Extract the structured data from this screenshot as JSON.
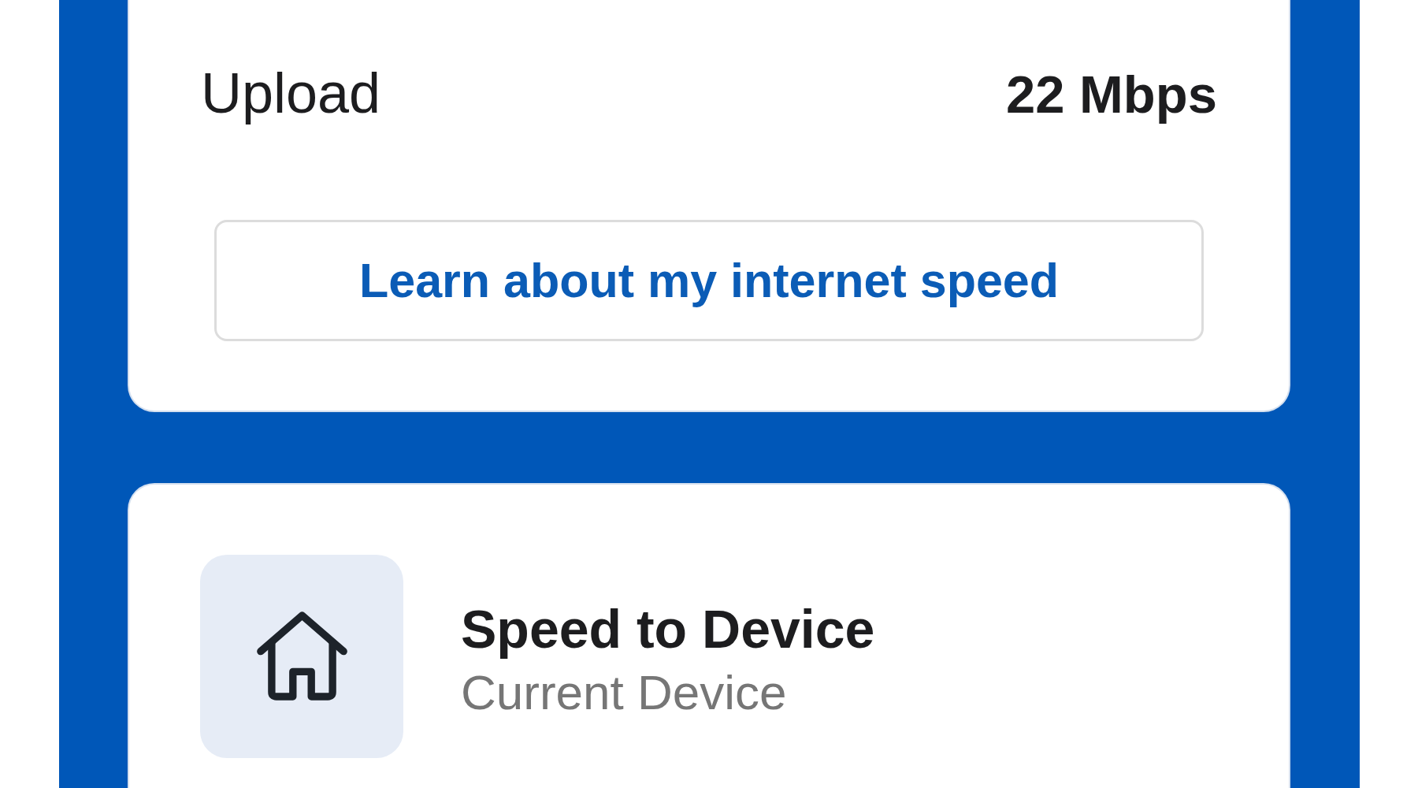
{
  "speed_card": {
    "rows": [
      {
        "label": "Upload",
        "value": "22 Mbps"
      }
    ],
    "button": {
      "label": "Learn about my internet speed"
    }
  },
  "device_card": {
    "title": "Speed to Device",
    "subtitle": "Current Device"
  }
}
